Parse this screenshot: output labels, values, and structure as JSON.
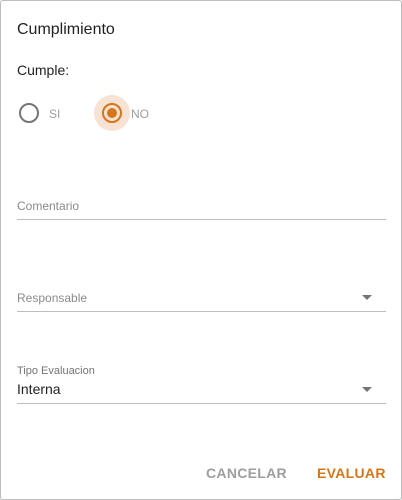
{
  "dialog": {
    "title": "Cumplimiento",
    "cumple_label": "Cumple:",
    "options": [
      {
        "label": "SI",
        "selected": false
      },
      {
        "label": "NO",
        "selected": true
      }
    ],
    "comentario_placeholder": "Comentario",
    "responsable_placeholder": "Responsable",
    "tipo_label": "Tipo Evaluacion",
    "tipo_value": "Interna",
    "cancel_label": "CANCELAR",
    "evaluate_label": "EVALUAR",
    "accent_color": "#d4761c"
  }
}
